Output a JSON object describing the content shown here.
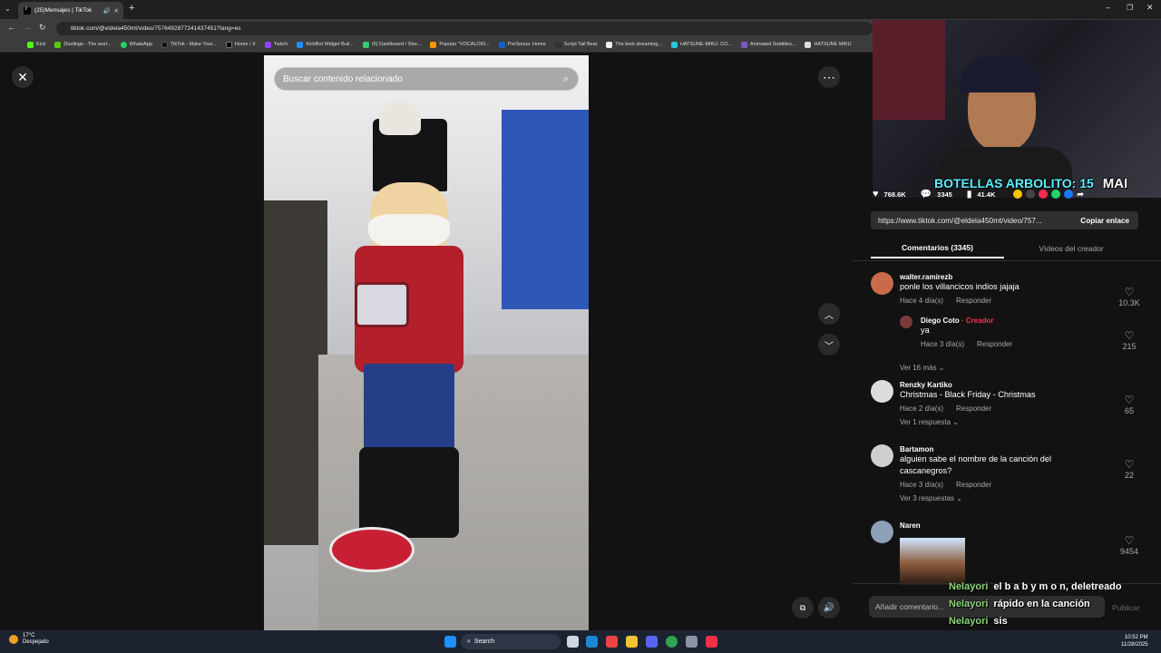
{
  "browser": {
    "tab_title": "(25)Mensajes | TikTok",
    "url": "tiktok.com/@eldela450mt/video/7576492877241437451?lang=es",
    "bookmarks": [
      "Kick",
      "Duolingo - The worl...",
      "WhatsApp",
      "TikTok - Make Your...",
      "Home / X",
      "Twitch",
      "KickBot Widget Buil...",
      "(5) Dashboard / Stre...",
      "Popular \"VOCALOID...",
      "PreSonus: Home",
      "Script Tail Beat",
      "The best streaming...",
      "HATSUNE MIKU: CO...",
      "Animated Subtitles...",
      "HATSUNE MIKU"
    ]
  },
  "video": {
    "search_placeholder": "Buscar contenido relacionado"
  },
  "stream_overlay": {
    "banner_text": "BOTELLAS ARBOLITO: 15",
    "banner_tag": "MAI"
  },
  "stats": {
    "likes": "768.6K",
    "comments": "3345",
    "saves": "41.4K"
  },
  "share": {
    "link": "https://www.tiktok.com/@eldela450mt/video/757...",
    "copy_label": "Copiar enlace"
  },
  "tabs": {
    "comments": "Comentarios (3345)",
    "creator_videos": "Vídeos del creador"
  },
  "comments": [
    {
      "user": "walter.ramirezb",
      "text": "ponle los villancicos indios jajaja",
      "time": "Hace 4 día(s)",
      "reply": "Responder",
      "likes": "10.3K"
    },
    {
      "user": "Diego Coto",
      "badge": "· Creador",
      "text": "ya",
      "time": "Hace 3 día(s)",
      "reply": "Responder",
      "likes": "215"
    },
    {
      "more": "Ver 16 más"
    },
    {
      "user": "Renzky Kartiko",
      "text": "Christmas - Black Friday - Christmas",
      "time": "Hace 2 día(s)",
      "reply": "Responder",
      "likes": "65",
      "more": "Ver 1 respuesta"
    },
    {
      "user": "Bartamon",
      "text": "alguien sabe el nombre de la canción del cascanegros?",
      "time": "Hace 3 día(s)",
      "reply": "Responder",
      "likes": "22",
      "more": "Ver 3 respuestas"
    },
    {
      "user": "Naren",
      "likes": "9454"
    }
  ],
  "composer": {
    "placeholder": "Añadir comentario...",
    "publish": "Publicar"
  },
  "chat": [
    {
      "name": "Nelayori",
      "msg": "el b a b y m o n, deletreado"
    },
    {
      "name": "Nelayori",
      "msg": "rápido en la canción"
    },
    {
      "name": "Nelayori",
      "msg": "sis"
    }
  ],
  "taskbar": {
    "temp": "17°C",
    "weather": "Despejado",
    "search": "Search",
    "time": "10:52 PM",
    "date": "11/28/2025"
  },
  "colors": {
    "creator": "#fe2c55",
    "chat_name": "#8bd67a",
    "banner": "#5ff0ff"
  }
}
